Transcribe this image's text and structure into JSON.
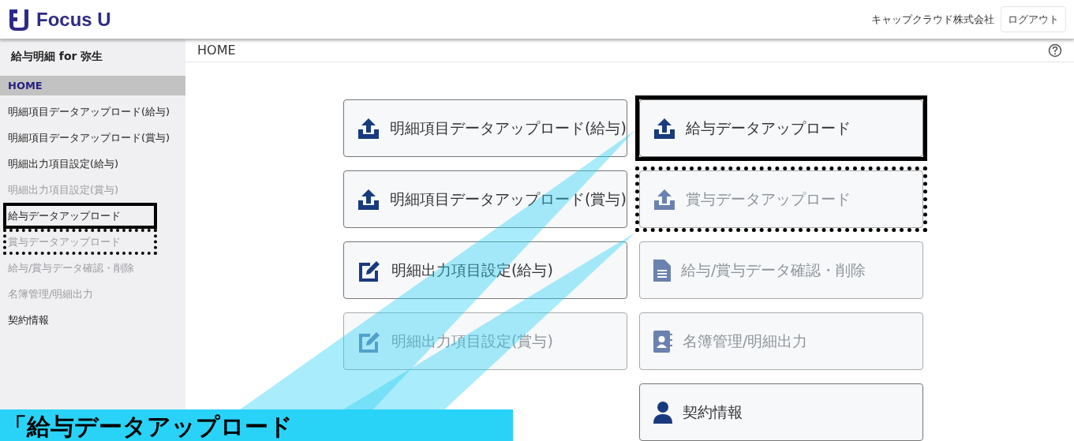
{
  "header": {
    "logo": "Focus U",
    "company": "キャップクラウド株式会社",
    "logout": "ログアウト"
  },
  "sidebar": {
    "title": "給与明細 for 弥生",
    "items": [
      {
        "label": "HOME",
        "selected": true,
        "disabled": false,
        "boxed": false,
        "dotted": false
      },
      {
        "label": "明細項目データアップロード(給与)",
        "selected": false,
        "disabled": false,
        "boxed": false,
        "dotted": false
      },
      {
        "label": "明細項目データアップロード(賞与)",
        "selected": false,
        "disabled": false,
        "boxed": false,
        "dotted": false
      },
      {
        "label": "明細出力項目設定(給与)",
        "selected": false,
        "disabled": false,
        "boxed": false,
        "dotted": false
      },
      {
        "label": "明細出力項目設定(賞与)",
        "selected": false,
        "disabled": true,
        "boxed": false,
        "dotted": false
      },
      {
        "label": "給与データアップロード",
        "selected": false,
        "disabled": false,
        "boxed": true,
        "dotted": false
      },
      {
        "label": "賞与データアップロード",
        "selected": false,
        "disabled": true,
        "boxed": false,
        "dotted": true
      },
      {
        "label": "給与/賞与データ確認・削除",
        "selected": false,
        "disabled": true,
        "boxed": false,
        "dotted": false
      },
      {
        "label": "名簿管理/明細出力",
        "selected": false,
        "disabled": true,
        "boxed": false,
        "dotted": false
      },
      {
        "label": "契約情報",
        "selected": false,
        "disabled": false,
        "boxed": false,
        "dotted": false
      }
    ]
  },
  "breadcrumb": "HOME",
  "left_buttons": [
    {
      "label": "明細項目データアップロード(給与)",
      "kind": "upload",
      "disabled": false,
      "boxed": false,
      "dotted": false
    },
    {
      "label": "明細項目データアップロード(賞与)",
      "kind": "upload",
      "disabled": false,
      "boxed": false,
      "dotted": false
    },
    {
      "label": "明細出力項目設定(給与)",
      "kind": "edit",
      "disabled": false,
      "boxed": false,
      "dotted": false
    },
    {
      "label": "明細出力項目設定(賞与)",
      "kind": "edit",
      "disabled": true,
      "boxed": false,
      "dotted": false
    }
  ],
  "right_buttons": [
    {
      "label": "給与データアップロード",
      "kind": "upload",
      "disabled": false,
      "boxed": true,
      "dotted": false
    },
    {
      "label": "賞与データアップロード",
      "kind": "upload",
      "disabled": true,
      "boxed": false,
      "dotted": true
    },
    {
      "label": "給与/賞与データ確認・削除",
      "kind": "document",
      "disabled": true,
      "boxed": false,
      "dotted": false
    },
    {
      "label": "名簿管理/明細出力",
      "kind": "contacts",
      "disabled": true,
      "boxed": false,
      "dotted": false
    },
    {
      "label": "契約情報",
      "kind": "person",
      "disabled": false,
      "boxed": false,
      "dotted": false
    }
  ],
  "callout": {
    "text": "「給与データアップロード"
  }
}
